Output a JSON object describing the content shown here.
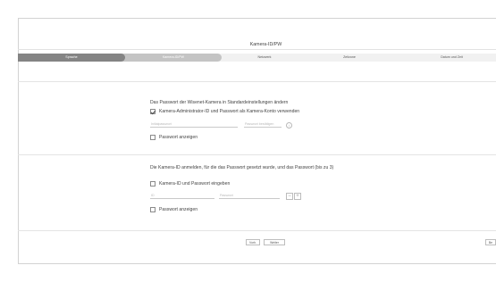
{
  "wizard": {
    "title": "Kamera-ID/PW",
    "steps": [
      {
        "label": "Sprache"
      },
      {
        "label": "Kamera-ID/PW"
      },
      {
        "label": "Netzwerk"
      },
      {
        "label": "Zeitzone"
      },
      {
        "label": "Datum und Zeit"
      }
    ],
    "progress_active_step": 2,
    "progress_total_steps": 5
  },
  "section1": {
    "heading": "Das Passwort der Wisenet-Kamera in Standardeinstellungen ändern",
    "use_admin_label": "Kamera-Administrator-ID und Passwort als Kamera-Konto verwenden",
    "use_admin_checked": true,
    "password_placeholder": "Initialpasswort",
    "confirm_placeholder": "Passwort bestätigen",
    "info_icon": "i",
    "show_password_label": "Passwort anzeigen",
    "show_password_checked": false
  },
  "section2": {
    "heading": "Die Kamera-ID anmelden, für die das Passwort gesetzt wurde, und das Passwort (bis zu 3)",
    "enter_label": "Kamera-ID und Passwort eingeben",
    "enter_checked": false,
    "id_placeholder": "ID",
    "password_placeholder": "Passwort",
    "remove_label": "−",
    "add_label": "+",
    "show_password_label": "Passwort anzeigen",
    "show_password_checked": false
  },
  "footer": {
    "prev_label": "Vorh.",
    "next_label": "Weiter",
    "right_label": "Be"
  }
}
